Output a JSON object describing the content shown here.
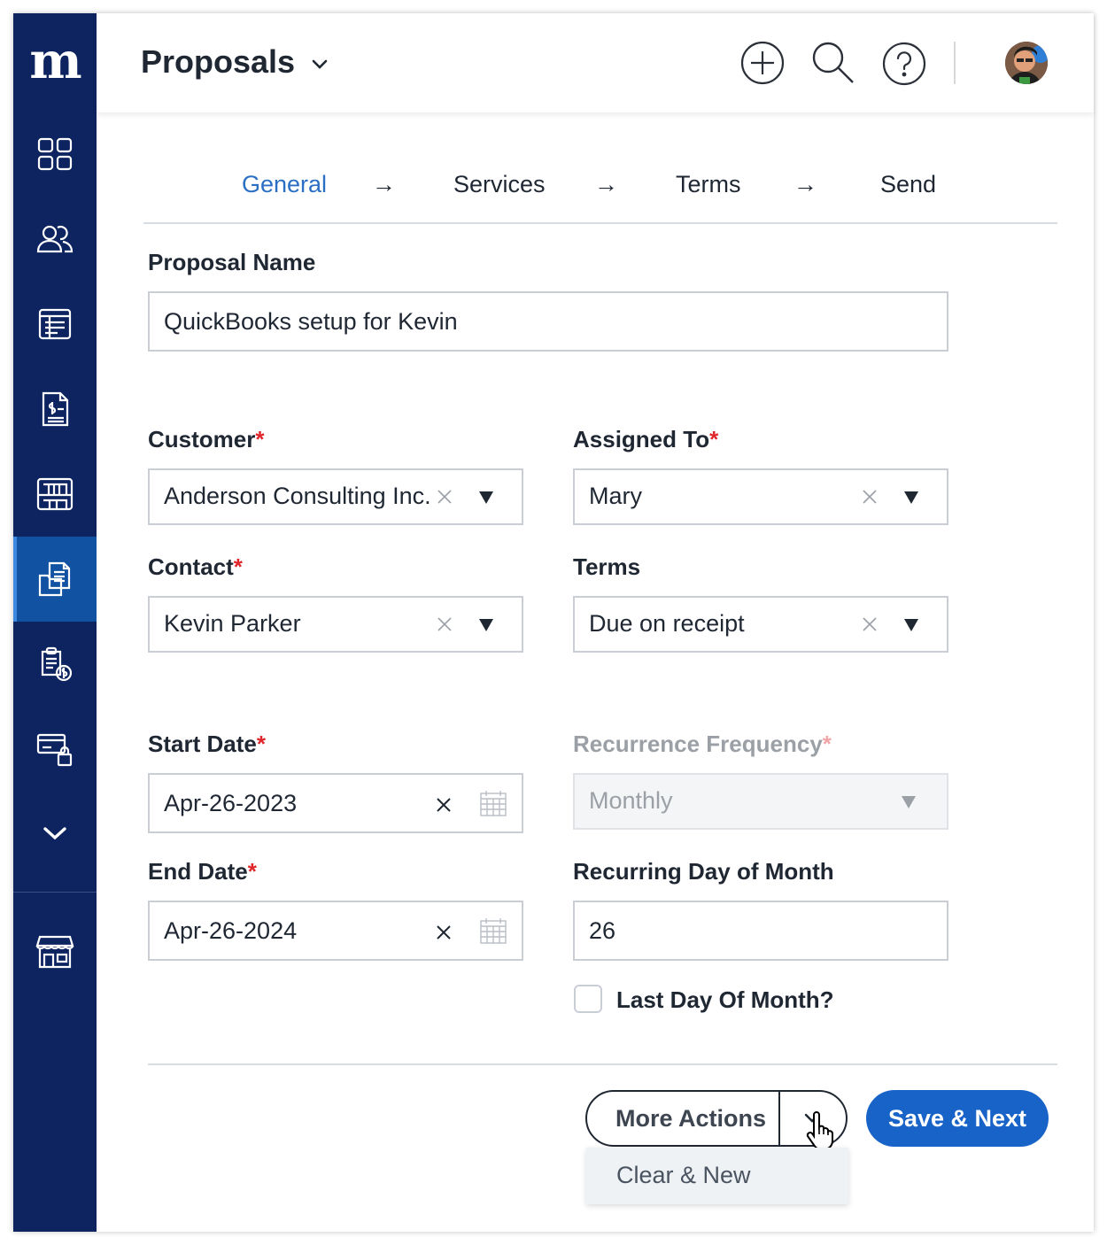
{
  "app": {
    "logo": "m"
  },
  "header": {
    "title": "Proposals"
  },
  "sidebar": {
    "items": [
      {
        "icon": "dashboard-icon"
      },
      {
        "icon": "customers-icon"
      },
      {
        "icon": "list-icon"
      },
      {
        "icon": "invoice-icon"
      },
      {
        "icon": "services-icon"
      },
      {
        "icon": "proposals-icon",
        "active": true
      },
      {
        "icon": "billing-clipboard-icon"
      },
      {
        "icon": "secure-payment-icon"
      },
      {
        "icon": "expand-chevron-icon"
      },
      {
        "icon": "store-icon"
      }
    ]
  },
  "steps": {
    "general": "General",
    "services": "Services",
    "terms": "Terms",
    "send": "Send",
    "arrow": "→"
  },
  "form": {
    "proposal_name": {
      "label": "Proposal Name",
      "value": "QuickBooks setup for Kevin"
    },
    "customer": {
      "label": "Customer",
      "required": "*",
      "value": "Anderson Consulting Inc."
    },
    "assigned_to": {
      "label": "Assigned To",
      "required": "*",
      "value": "Mary"
    },
    "contact": {
      "label": "Contact",
      "required": "*",
      "value": "Kevin Parker"
    },
    "terms": {
      "label": "Terms",
      "value": "Due on receipt"
    },
    "start_date": {
      "label": "Start Date",
      "required": "*",
      "value": "Apr-26-2023"
    },
    "recurrence_frequency": {
      "label": "Recurrence Frequency",
      "required": "*",
      "value": "Monthly"
    },
    "end_date": {
      "label": "End Date",
      "required": "*",
      "value": "Apr-26-2024"
    },
    "recurring_day": {
      "label": "Recurring Day of Month",
      "value": "26"
    },
    "last_day": {
      "label": "Last Day Of Month?",
      "checked": false
    }
  },
  "actions": {
    "more_actions": "More Actions",
    "save_next": "Save & Next",
    "menu": [
      "Clear & New"
    ]
  },
  "colors": {
    "sidebar": "#0d2460",
    "sidebar_active": "#1252a3",
    "accent": "#1863c8",
    "required": "#e0252a"
  }
}
